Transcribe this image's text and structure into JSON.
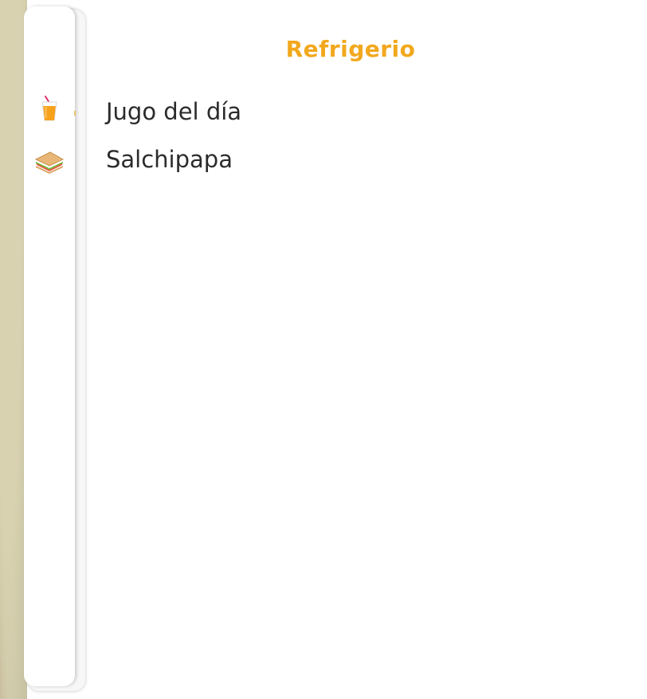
{
  "section": {
    "title": "Refrigerio",
    "title_color": "#f2a81d"
  },
  "menu": {
    "items": [
      {
        "label": "Jugo del día",
        "icon": "juice-icon"
      },
      {
        "label": "Salchipapa",
        "icon": "sandwich-icon"
      }
    ]
  }
}
